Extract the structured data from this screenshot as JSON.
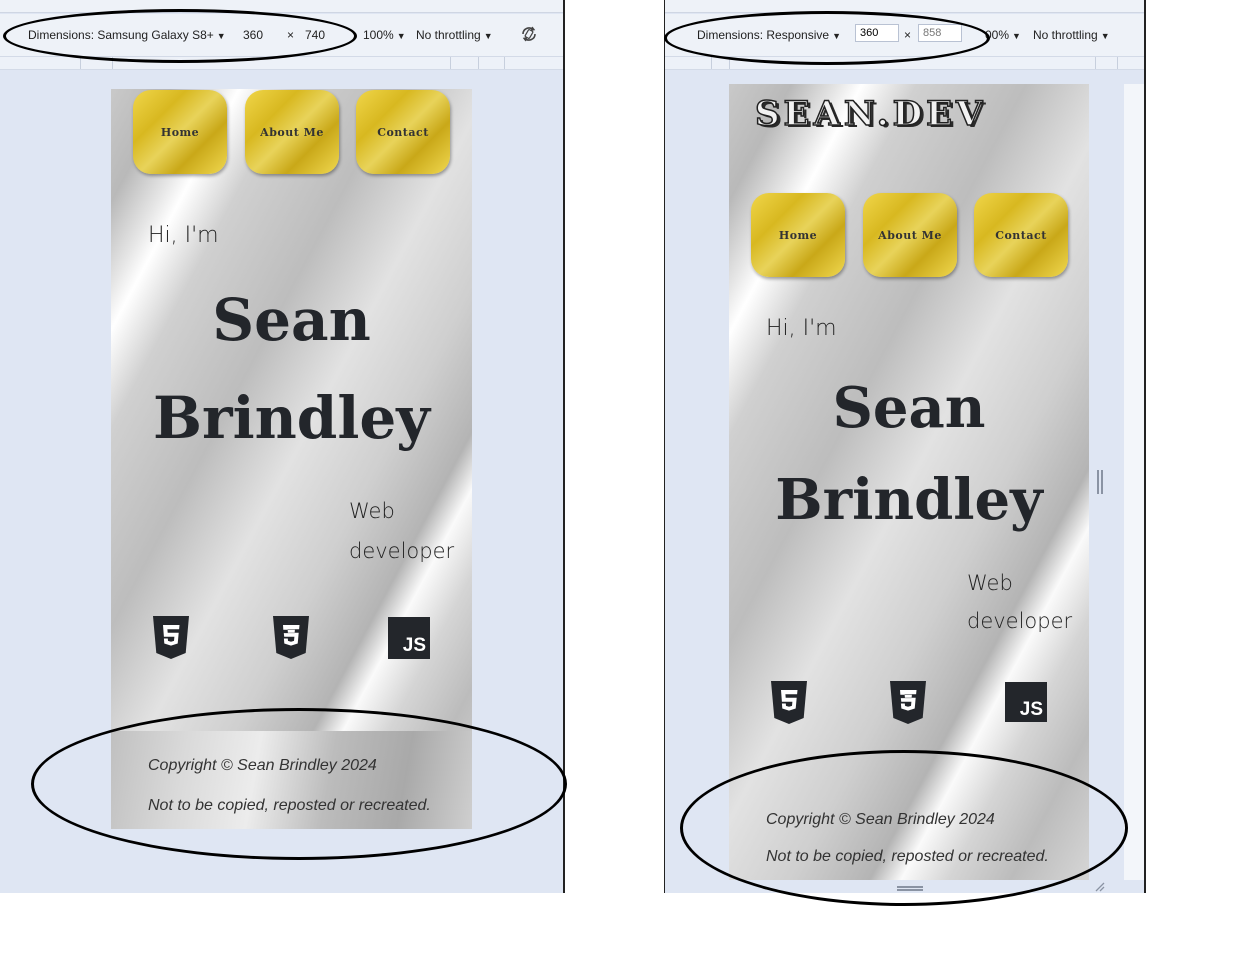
{
  "left": {
    "toolbar": {
      "dimensions": "Dimensions: Samsung Galaxy S8+",
      "width": "360",
      "times": "×",
      "height": "740",
      "zoom": "100%",
      "throttle": "No throttling",
      "rotate_icon": "rotate-icon"
    }
  },
  "right": {
    "toolbar": {
      "dimensions": "Dimensions: Responsive",
      "width": "360",
      "times": "×",
      "height": "858",
      "zoom": "00%",
      "throttle": "No throttling"
    }
  },
  "site": {
    "brand": "SEAN.DEV",
    "nav": [
      "Home",
      "About Me",
      "Contact"
    ],
    "greeting": "Hi,  I'm",
    "first_name": "Sean",
    "last_name": "Brindley",
    "role_line1": "Web",
    "role_line2": "developer",
    "tech_icons": [
      "html5-icon",
      "css3-icon",
      "javascript-icon"
    ],
    "tech_js_label": "JS",
    "footer_copyright": "Copyright © Sean Brindley 2024",
    "footer_note": "Not to be copied, reposted or recreated."
  },
  "colors": {
    "gold": "#e0c534",
    "text_dark": "#23262b",
    "devtools_bg": "#dfe6f3"
  }
}
